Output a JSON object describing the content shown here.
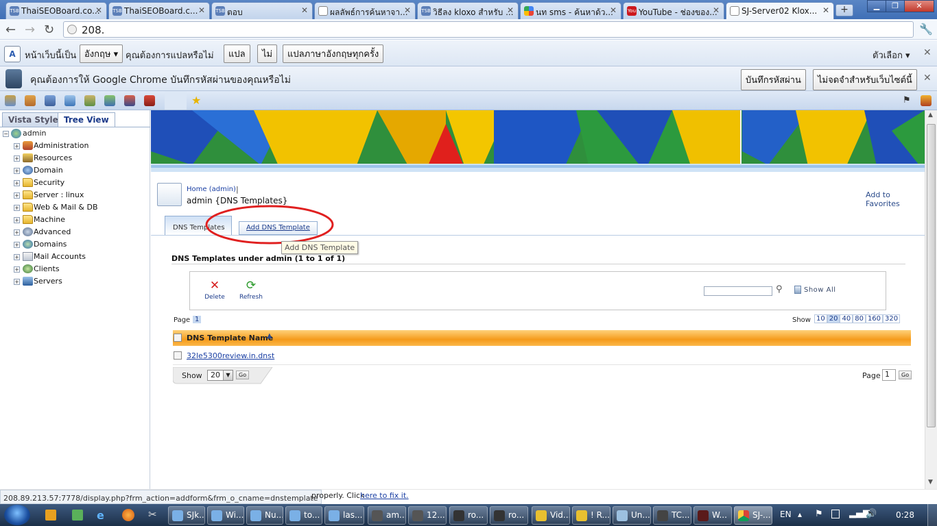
{
  "tabs": [
    {
      "label": "ThaiSEOBoard.co...",
      "icon": "tsb"
    },
    {
      "label": "ThaiSEOBoard.c...",
      "icon": "tsb"
    },
    {
      "label": "ตอบ",
      "icon": "tsb"
    },
    {
      "label": "ผลลัพธ์การค้นหาจา...",
      "icon": "page"
    },
    {
      "label": "วิธีลง kloxo สำหรับ ...",
      "icon": "tsb"
    },
    {
      "label": "นท sms - ค้นหาด้ว...",
      "icon": "google"
    },
    {
      "label": "YouTube - ช่องของ...",
      "icon": "youtube"
    },
    {
      "label": "SJ-Server02 Klox...",
      "icon": "page"
    }
  ],
  "address": "208.",
  "translate_bar": {
    "prefix": "หน้าเว็บนี้เป็น",
    "language": "อังกฤษ",
    "question": "คุณต้องการแปลหรือไม่",
    "translate": "แปล",
    "no": "ไม่",
    "always": "แปลภาษาอังกฤษทุกครั้ง",
    "options": "ตัวเลือก"
  },
  "password_bar": {
    "message": "คุณต้องการให้ Google Chrome บันทึกรหัสผ่านของคุณหรือไม่",
    "save": "บันทึกรหัสผ่าน",
    "never": "ไม่จดจำสำหรับเว็บไซต์นี้"
  },
  "left_tabs": {
    "vista": "Vista Style",
    "tree": "Tree View"
  },
  "tree": {
    "root": "admin",
    "items": [
      {
        "label": "Administration",
        "icon": "admin-icon"
      },
      {
        "label": "Resources",
        "icon": "resources-icon"
      },
      {
        "label": "Domain",
        "icon": "domain-icon"
      },
      {
        "label": "Security",
        "icon": "folder-icon"
      },
      {
        "label": "Server : linux",
        "icon": "folder-icon"
      },
      {
        "label": "Web & Mail & DB",
        "icon": "folder-icon"
      },
      {
        "label": "Machine",
        "icon": "folder-icon"
      },
      {
        "label": "Advanced",
        "icon": "advanced-icon"
      },
      {
        "label": "Domains",
        "icon": "domains-icon"
      },
      {
        "label": "Mail Accounts",
        "icon": "mail-icon"
      },
      {
        "label": "Clients",
        "icon": "clients-icon"
      },
      {
        "label": "Servers",
        "icon": "servers-icon"
      }
    ]
  },
  "main": {
    "breadcrumb": "Home (admin)",
    "breadcrumb_sep": "|",
    "title": "admin {DNS Templates}",
    "add_favorites": "Add to Favorites",
    "tab_list": "DNS Templates",
    "tab_add": "Add DNS Template",
    "tooltip": "Add DNS Template",
    "section_title": "DNS Templates under admin (1 to 1 of 1)",
    "delete": "Delete",
    "refresh": "Refresh",
    "show_all": "Show All",
    "page_label": "Page",
    "page_current": "1",
    "show_label": "Show",
    "show_options": [
      "10",
      "20",
      "40",
      "80",
      "160",
      "320"
    ],
    "show_selected": "20",
    "column_header": "DNS Template Name",
    "rows": [
      "32le5300review.in.dnst"
    ],
    "footer_show_label": "Show",
    "footer_show_value": "20",
    "go": "Go",
    "footer_page_label": "Page",
    "footer_page_value": "1"
  },
  "status": {
    "url": "208.89.213.57:7778/display.php?frm_action=addform&frm_o_cname=dnstemplate",
    "message": "properly. Click",
    "fix_link": "here to fix it."
  },
  "taskbar": {
    "items": [
      "SJk...",
      "Wi...",
      "Nu...",
      "to...",
      "las...",
      "am...",
      "12...",
      "ro...",
      "ro...",
      "Vid...",
      "! R...",
      "Un...",
      "TC...",
      "W...",
      "SJ-..."
    ],
    "lang": "EN",
    "clock": "0:28"
  }
}
